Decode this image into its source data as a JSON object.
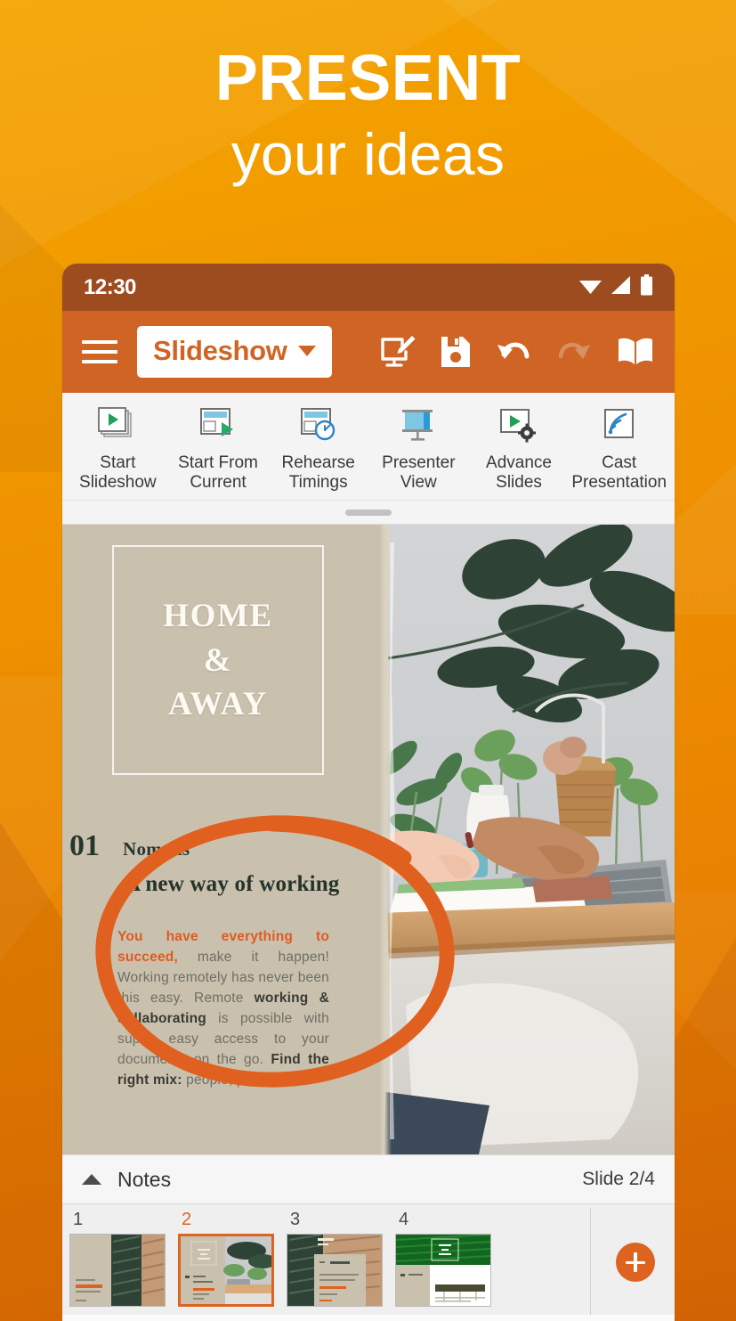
{
  "hero": {
    "line1": "PRESENT",
    "line2": "your ideas"
  },
  "colors": {
    "background_top": "#f5a400",
    "background_bottom": "#dd6a05",
    "status_bar": "#9d4c1f",
    "app_bar": "#cf6424",
    "accent_orange": "#dd6321",
    "ribbon_bg": "#f4f4f4",
    "slide_bg": "#c9c1ae",
    "annotation": "#e06020"
  },
  "status_bar": {
    "time": "12:30",
    "icons": [
      "wifi-icon",
      "cellular-signal-icon",
      "battery-icon"
    ]
  },
  "app_bar": {
    "menu_icon": "hamburger-menu-icon",
    "mode_label": "Slideshow",
    "dropdown_icon": "chevron-down-icon",
    "actions": [
      {
        "name": "present-icon",
        "label": "Present"
      },
      {
        "name": "save-icon",
        "label": "Save"
      },
      {
        "name": "undo-icon",
        "label": "Undo"
      },
      {
        "name": "redo-icon",
        "label": "Redo"
      },
      {
        "name": "read-mode-icon",
        "label": "Read Mode"
      }
    ]
  },
  "ribbon": {
    "items": [
      {
        "label": "Start\nSlideshow",
        "icon": "start-slideshow-icon"
      },
      {
        "label": "Start From\nCurrent",
        "icon": "start-from-current-icon"
      },
      {
        "label": "Rehearse\nTimings",
        "icon": "rehearse-timings-icon"
      },
      {
        "label": "Presenter\nView",
        "icon": "presenter-view-icon"
      },
      {
        "label": "Advance\nSlides",
        "icon": "advance-slides-icon"
      },
      {
        "label": "Cast\nPresentation",
        "icon": "cast-presentation-icon"
      }
    ]
  },
  "slide": {
    "title": "HOME\n&\nAWAY",
    "section_number": "01",
    "section_name": "Nomads",
    "section_subtitle": "A new way of working",
    "body_lead": "You have everything to succeed,",
    "body_part1": " make it happen! Working remotely has never been this easy. Remote ",
    "body_bold1": "working & collaborating",
    "body_part2": " is possible with super easy access to your documents on the go. ",
    "body_bold2": "Find the right mix:",
    "body_part3": " people, places and"
  },
  "notes_bar": {
    "collapse_icon": "chevron-up-icon",
    "label": "Notes",
    "slide_counter": "Slide 2/4"
  },
  "thumbnails": {
    "items": [
      {
        "number": "1",
        "selected": false
      },
      {
        "number": "2",
        "selected": true
      },
      {
        "number": "3",
        "selected": false
      },
      {
        "number": "4",
        "selected": false
      }
    ],
    "add_button_icon": "add-slide-icon"
  }
}
